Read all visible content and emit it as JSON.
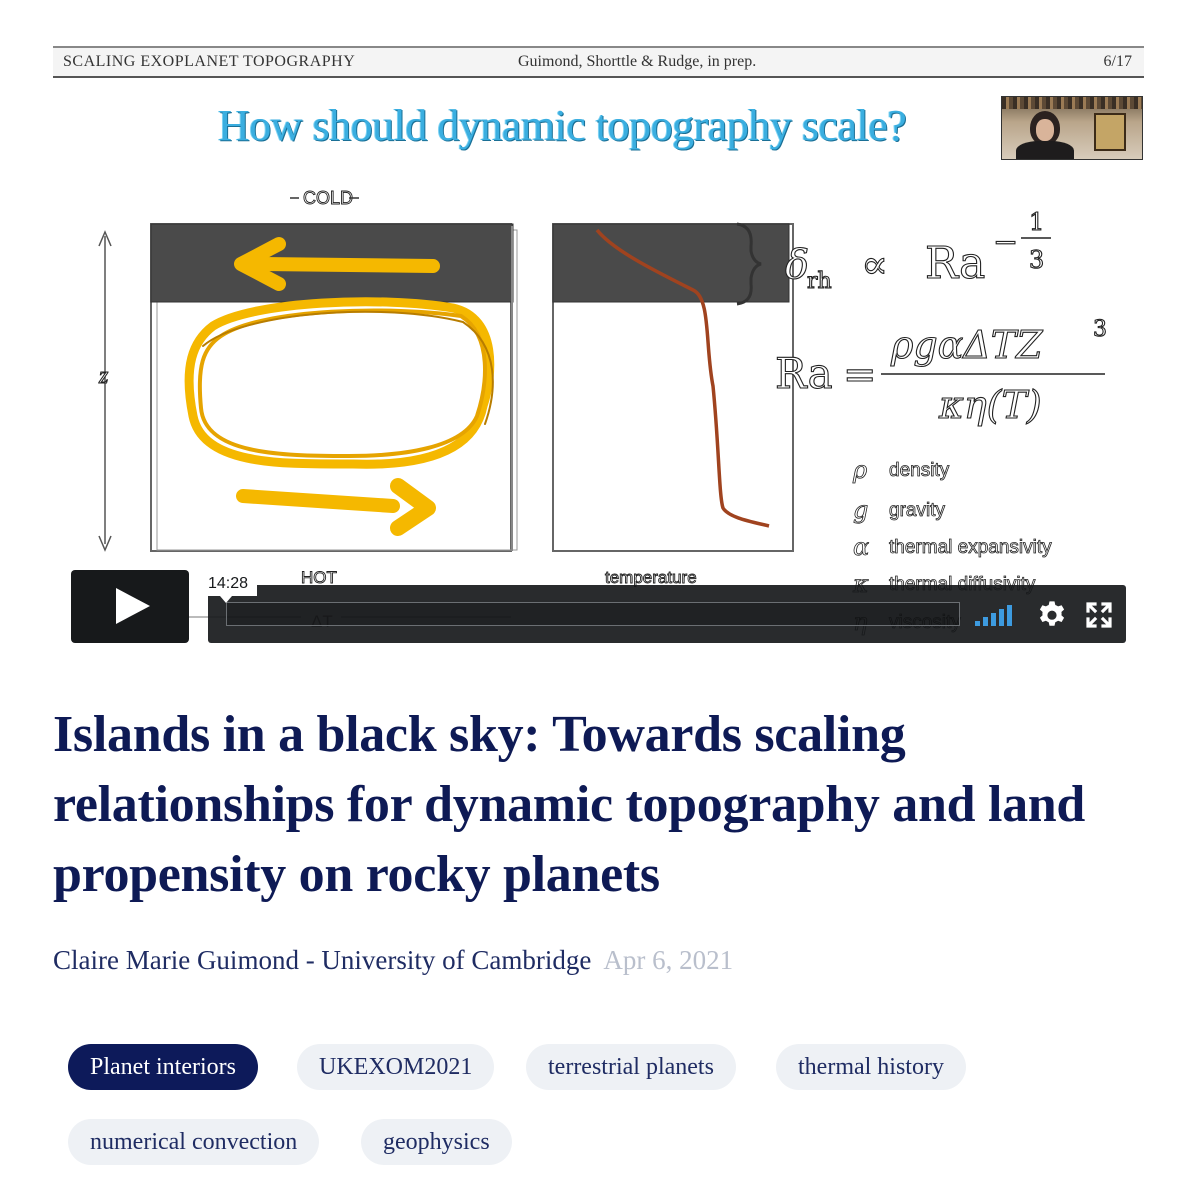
{
  "video": {
    "slide": {
      "header_left": "SCALING EXOPLANET TOPOGRAPHY",
      "header_middle": "Guimond, Shorttle & Rudge, in prep.",
      "header_right": "6/17",
      "title": "How should dynamic topography scale?",
      "label_cold": "COLD",
      "label_hot": "HOT",
      "label_z": "z",
      "label_temperature": "temperature",
      "label_delta_t": "ΔT",
      "eq1_lhs": "δ",
      "eq1_lhs_sub": "rh",
      "eq1_prop": "∝",
      "eq1_rhs": "Ra",
      "eq1_exp_sign": "−",
      "eq1_exp_num": "1",
      "eq1_exp_den": "3",
      "eq2_lhs": "Ra",
      "eq2_eq": "=",
      "eq2_numerator": "ρgαΔTZ",
      "eq2_num_exp": "3",
      "eq2_denominator": "κη(T)",
      "legend": [
        {
          "symbol": "ρ",
          "desc": "density"
        },
        {
          "symbol": "g",
          "desc": "gravity"
        },
        {
          "symbol": "α",
          "desc": "thermal expansivity"
        },
        {
          "symbol": "κ",
          "desc": "thermal diffusivity"
        },
        {
          "symbol": "η",
          "desc": "viscosity"
        }
      ]
    },
    "player": {
      "time": "14:28",
      "volume_level": 1.0
    },
    "colors": {
      "accent": "#3d9be0",
      "arrow": "#f5b800",
      "title_blue": "#3aaee0"
    }
  },
  "title": "Islands in a black sky: Towards scaling relationships for dynamic topography and land propensity on rocky planets",
  "author": "Claire Marie Guimond - University of Cambridge",
  "date": "Apr 6, 2021",
  "tags": [
    {
      "label": "Planet interiors",
      "active": true
    },
    {
      "label": "UKEXOM2021",
      "active": false
    },
    {
      "label": "terrestrial planets",
      "active": false
    },
    {
      "label": "thermal history",
      "active": false
    },
    {
      "label": "numerical convection",
      "active": false
    },
    {
      "label": "geophysics",
      "active": false
    }
  ]
}
